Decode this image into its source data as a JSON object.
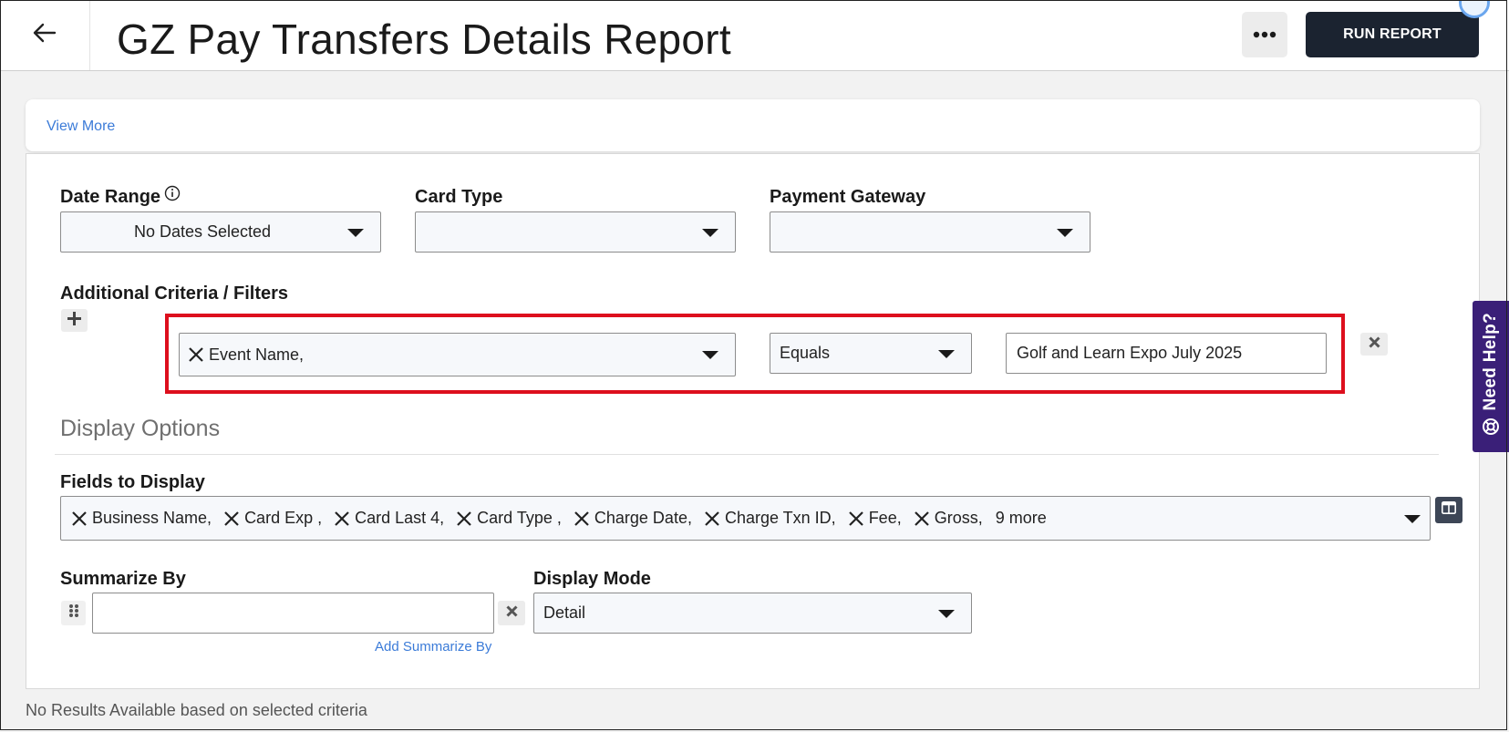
{
  "header": {
    "title": "GZ Pay Transfers Details Report",
    "run_report_label": "RUN REPORT"
  },
  "view_more": {
    "label": "View More"
  },
  "filters": {
    "date_range": {
      "label": "Date Range",
      "value": "No Dates Selected"
    },
    "card_type": {
      "label": "Card Type",
      "value": ""
    },
    "payment_gateway": {
      "label": "Payment Gateway",
      "value": ""
    }
  },
  "additional_criteria": {
    "label": "Additional Criteria / Filters",
    "field": "Event Name,",
    "operator": "Equals",
    "value": "Golf and Learn Expo July 2025"
  },
  "display_options": {
    "title": "Display Options",
    "fields_label": "Fields to Display",
    "fields": [
      "Business Name,",
      "Card Exp ,",
      "Card Last 4,",
      "Card Type ,",
      "Charge Date,",
      "Charge Txn ID,",
      "Fee,",
      "Gross,"
    ],
    "more_label": "9 more",
    "summarize_by_label": "Summarize By",
    "summarize_by_value": "",
    "add_summarize_label": "Add Summarize By",
    "display_mode_label": "Display Mode",
    "display_mode_value": "Detail"
  },
  "footer": {
    "no_results": "No Results Available based on selected criteria"
  },
  "help": {
    "label": "Need Help?"
  },
  "colors": {
    "accent_link": "#3b7bd8",
    "run_button": "#1b2330",
    "highlight": "#dd0f1d",
    "help_tab": "#3a1f78"
  },
  "icons": [
    "back-arrow-icon",
    "ellipsis-icon",
    "info-icon",
    "plus-icon",
    "remove-x-icon",
    "caret-down-icon",
    "columns-icon",
    "drag-handle-icon",
    "lifebuoy-icon"
  ]
}
